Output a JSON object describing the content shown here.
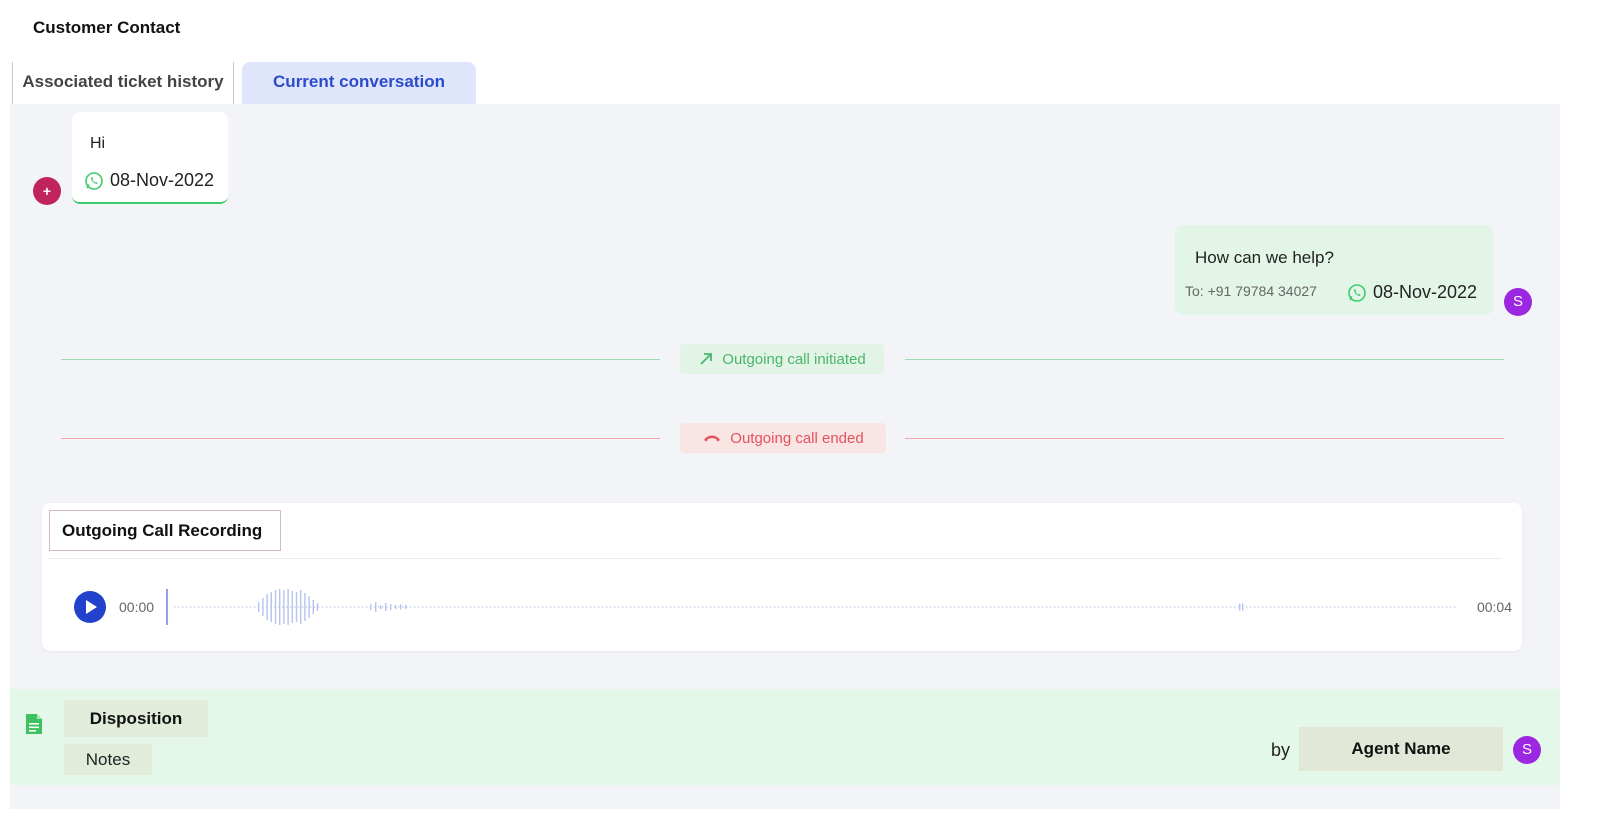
{
  "header": {
    "title": "Customer Contact"
  },
  "tabs": [
    {
      "label": "Associated ticket history",
      "active": false
    },
    {
      "label": "Current conversation",
      "active": true
    }
  ],
  "conversation": {
    "incoming": {
      "avatar": "+",
      "text": "Hi",
      "channel_icon": "whatsapp-icon",
      "date": "08-Nov-2022"
    },
    "outgoing": {
      "avatar": "S",
      "text": "How can we help?",
      "to": "To: +91 79784 34027",
      "channel_icon": "whatsapp-icon",
      "date": "08-Nov-2022"
    },
    "events": [
      {
        "label": "Outgoing call initiated",
        "icon": "arrow-up-right-icon",
        "color": "#4ab66b"
      },
      {
        "label": "Outgoing call ended",
        "icon": "hang-up-icon",
        "color": "#e4525c"
      }
    ]
  },
  "recording": {
    "title": "Outgoing Call Recording",
    "current_time": "00:00",
    "duration": "00:04",
    "play_icon": "play-icon"
  },
  "disposition": {
    "icon": "document-icon",
    "label": "Disposition",
    "notes": "Notes",
    "by": "by",
    "agent_name": "Agent Name",
    "agent_avatar": "S"
  },
  "colors": {
    "accent": "#2242cc",
    "whatsapp": "#3fcc6a",
    "avatar_customer": "#c0245d",
    "avatar_agent": "#9b27e0"
  }
}
